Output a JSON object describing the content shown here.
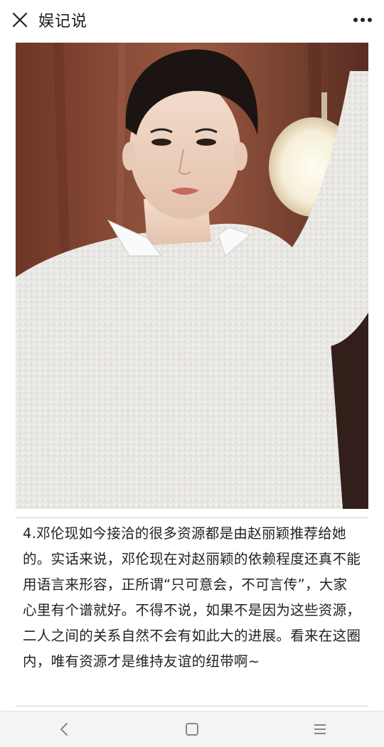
{
  "header": {
    "title": "娱记说",
    "close_icon": "close-icon",
    "more_icon": "more-dots-icon"
  },
  "article": {
    "image_icon": "portrait-photo",
    "paragraph": "4.邓伦现如今接洽的很多资源都是由赵丽颖推荐给她的。实话来说，邓伦现在对赵丽颖的依赖程度还真不能用语言来形容，正所谓“只可意会，不可言传”，大家心里有个谱就好。不得不说，如果不是因为这些资源，二人之间的关系自然不会有如此大的进展。看来在这圈内，唯有资源才是维持友谊的纽带啊~"
  },
  "navbar": {
    "back_icon": "back-chevron-icon",
    "home_icon": "home-square-icon",
    "menu_icon": "menu-lines-icon"
  },
  "colors": {
    "background": "#ffffff",
    "text": "#222222",
    "navbar_bg": "#f4f4f4",
    "photo_wall": "#7a3f2e",
    "sweater": "#e8e6e3"
  }
}
